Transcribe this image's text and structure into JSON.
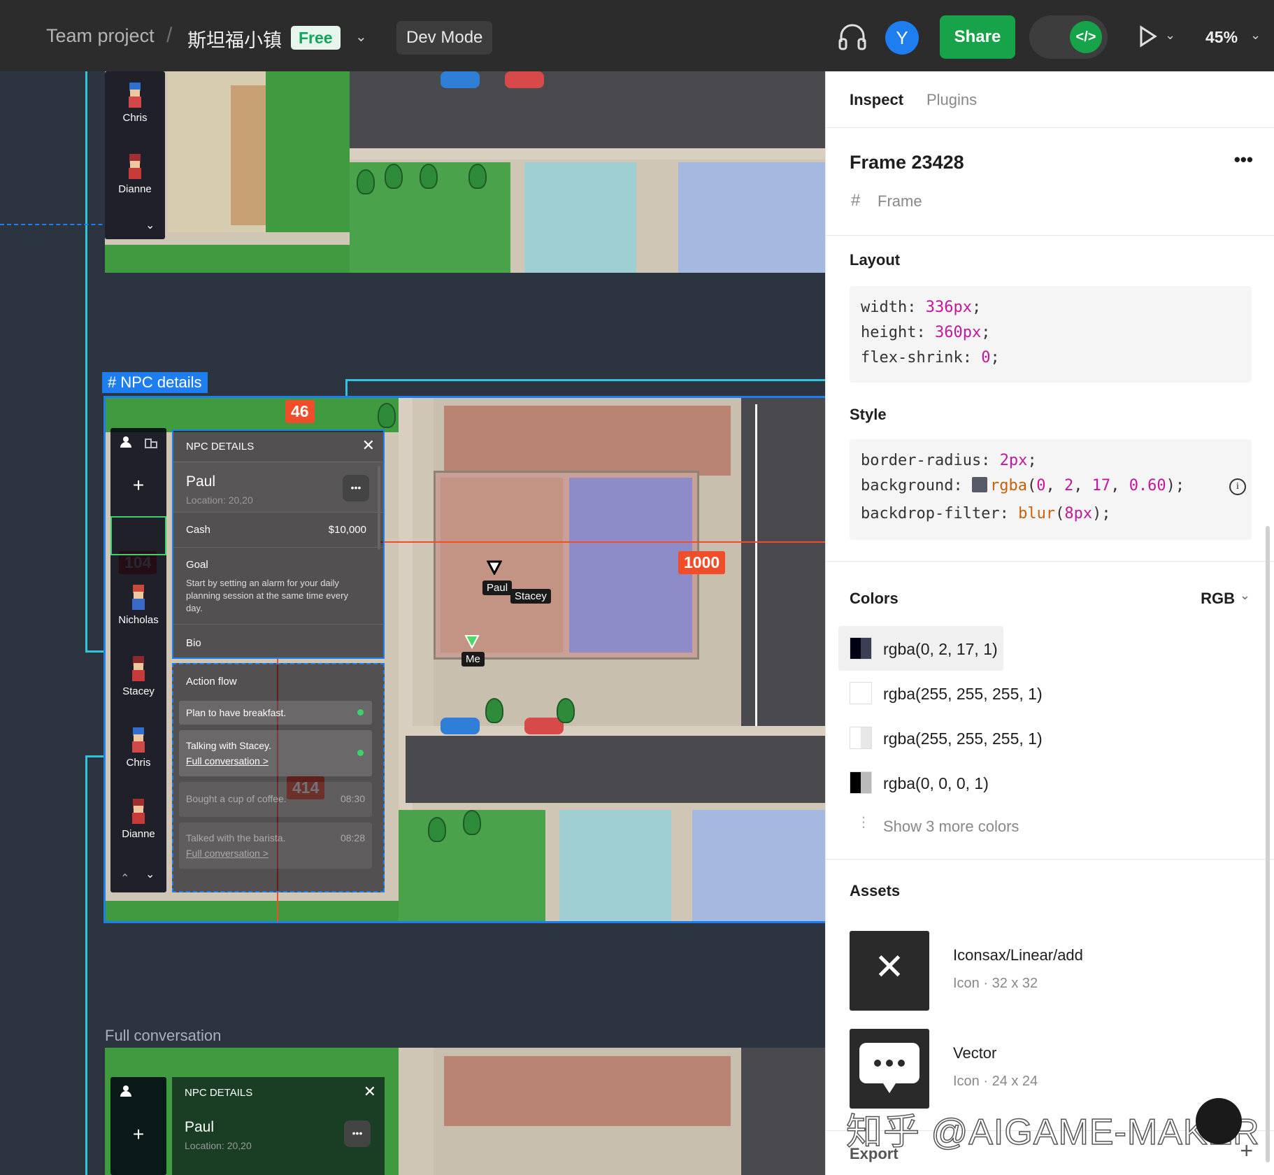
{
  "topbar": {
    "project": "Team project",
    "separator": "/",
    "file_name": "斯坦福小镇",
    "plan_badge": "Free",
    "dev_mode": "Dev Mode",
    "avatar_initial": "Y",
    "share": "Share",
    "dev_toggle_icon": "</>",
    "zoom": "45%"
  },
  "canvas": {
    "frame_label": "# NPC details",
    "badges": {
      "top": "46",
      "left": "104",
      "right": "1000",
      "bottom": "414"
    },
    "sidebar_top": [
      "Chris",
      "Dianne"
    ],
    "sidebar_main": [
      "Nicholas",
      "Stacey",
      "Chris",
      "Dianne"
    ],
    "map_labels": {
      "paul": "Paul",
      "stacey": "Stacey",
      "me": "Me"
    },
    "npc_panel": {
      "header": "NPC DETAILS",
      "name": "Paul",
      "location": "Location: 20,20",
      "cash_label": "Cash",
      "cash_value": "$10,000",
      "goal_label": "Goal",
      "goal_text": "Start by setting an alarm for your daily planning session at the same time every day.",
      "bio_label": "Bio"
    },
    "action_flow": {
      "title": "Action flow",
      "items": [
        {
          "text": "Plan to have breakfast.",
          "time": ""
        },
        {
          "text": "Talking with Stacey.",
          "link": "Full conversation >",
          "time": ""
        },
        {
          "text": "Bought a cup of coffee.",
          "time": "08:30"
        },
        {
          "text": "Talked with the barista.",
          "link": "Full conversation >",
          "time": "08:28"
        }
      ]
    },
    "full_conversation_label": "Full conversation",
    "bottom_panel": {
      "header": "NPC DETAILS",
      "name": "Paul",
      "location": "Location: 20,20"
    }
  },
  "inspect": {
    "tabs": {
      "inspect": "Inspect",
      "plugins": "Plugins"
    },
    "frame_name": "Frame 23428",
    "frame_type": "Frame",
    "layout": {
      "title": "Layout",
      "lines": [
        {
          "prop": "width: ",
          "val": "336px",
          "end": ";"
        },
        {
          "prop": "height: ",
          "val": "360px",
          "end": ";"
        },
        {
          "prop": "flex-shrink: ",
          "val": "0",
          "end": ";"
        }
      ]
    },
    "style": {
      "title": "Style",
      "border_radius_prop": "border-radius: ",
      "border_radius_val": "2px",
      "background_prop": "background: ",
      "background_fn": "rgba",
      "background_args": [
        "0",
        "2",
        "17",
        "0.60"
      ],
      "backdrop_prop": "backdrop-filter: ",
      "backdrop_fn": "blur",
      "backdrop_val": "8px"
    },
    "colors": {
      "title": "Colors",
      "mode": "RGB",
      "items": [
        "rgba(0, 2, 17, 1)",
        "rgba(255, 255, 255, 1)",
        "rgba(255, 255, 255, 1)",
        "rgba(0, 0, 0, 1)"
      ],
      "more": "Show 3 more colors"
    },
    "assets": {
      "title": "Assets",
      "items": [
        {
          "name": "Iconsax/Linear/add",
          "meta": "Icon · 32 x 32"
        },
        {
          "name": "Vector",
          "meta": "Icon · 24 x 24"
        }
      ]
    },
    "export": "Export"
  },
  "watermark": "知乎 @AIGAME-MAKER",
  "colors": {
    "accent": "#1e7ef0",
    "share": "#16a34a",
    "badge": "#f04e2a",
    "panel_bg": "#000211"
  }
}
